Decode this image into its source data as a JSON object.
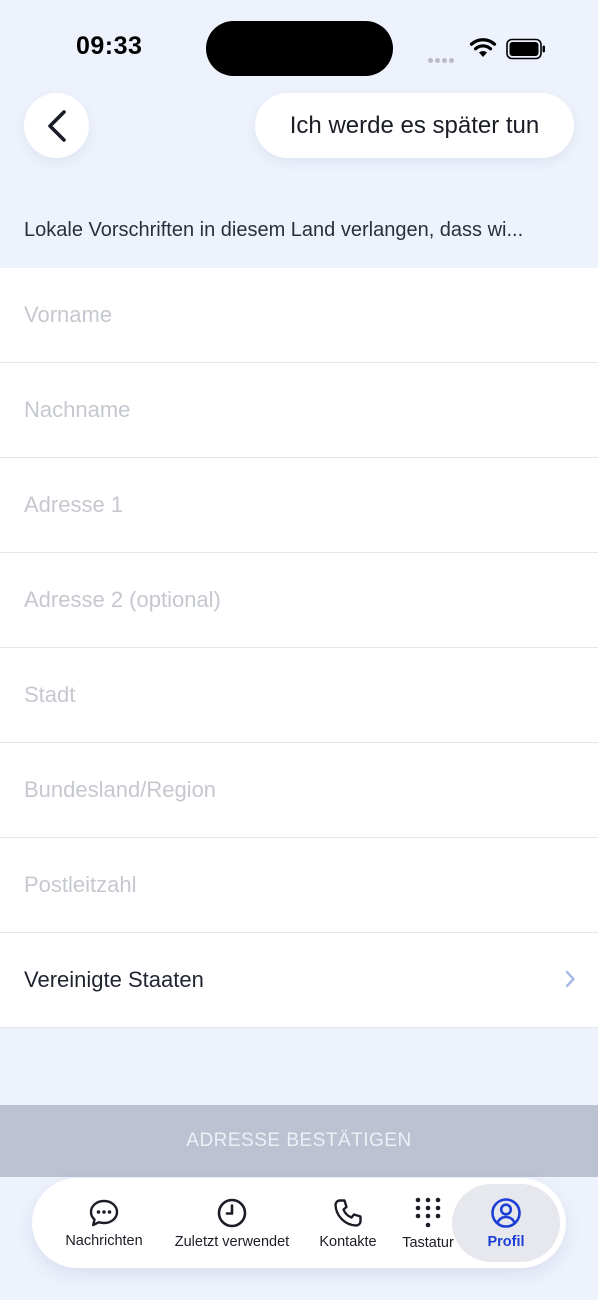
{
  "status_bar": {
    "time": "09:33"
  },
  "header": {
    "back_icon": "chevron-left-icon",
    "later_label": "Ich werde es später tun"
  },
  "notice": "Lokale Vorschriften in diesem Land verlangen, dass wi...",
  "form": {
    "first_name": {
      "placeholder": "Vorname",
      "value": ""
    },
    "last_name": {
      "placeholder": "Nachname",
      "value": ""
    },
    "address1": {
      "placeholder": "Adresse 1",
      "value": ""
    },
    "address2": {
      "placeholder": "Adresse 2 (optional)",
      "value": ""
    },
    "city": {
      "placeholder": "Stadt",
      "value": ""
    },
    "state": {
      "placeholder": "Bundesland/Region",
      "value": ""
    },
    "zip": {
      "placeholder": "Postleitzahl",
      "value": ""
    },
    "country": "Vereinigte Staaten"
  },
  "confirm_label": "ADRESSE BESTÄTIGEN",
  "tab_bar": {
    "active": "Profil",
    "tabs": [
      {
        "label": "Nachrichten",
        "icon": "chat-bubble-icon"
      },
      {
        "label": "Zuletzt verwendet",
        "icon": "clock-icon"
      },
      {
        "label": "Kontakte",
        "icon": "phone-icon"
      },
      {
        "label": "Tastatur",
        "icon": "keypad-icon"
      },
      {
        "label": "Profil",
        "icon": "profile-icon"
      }
    ]
  },
  "colors": {
    "background": "#eef2fc",
    "accent": "#1d3fd6",
    "confirm_disabled": "#bcc2d2",
    "placeholder": "#c5c8cf",
    "chevron": "#a9b9e8"
  }
}
